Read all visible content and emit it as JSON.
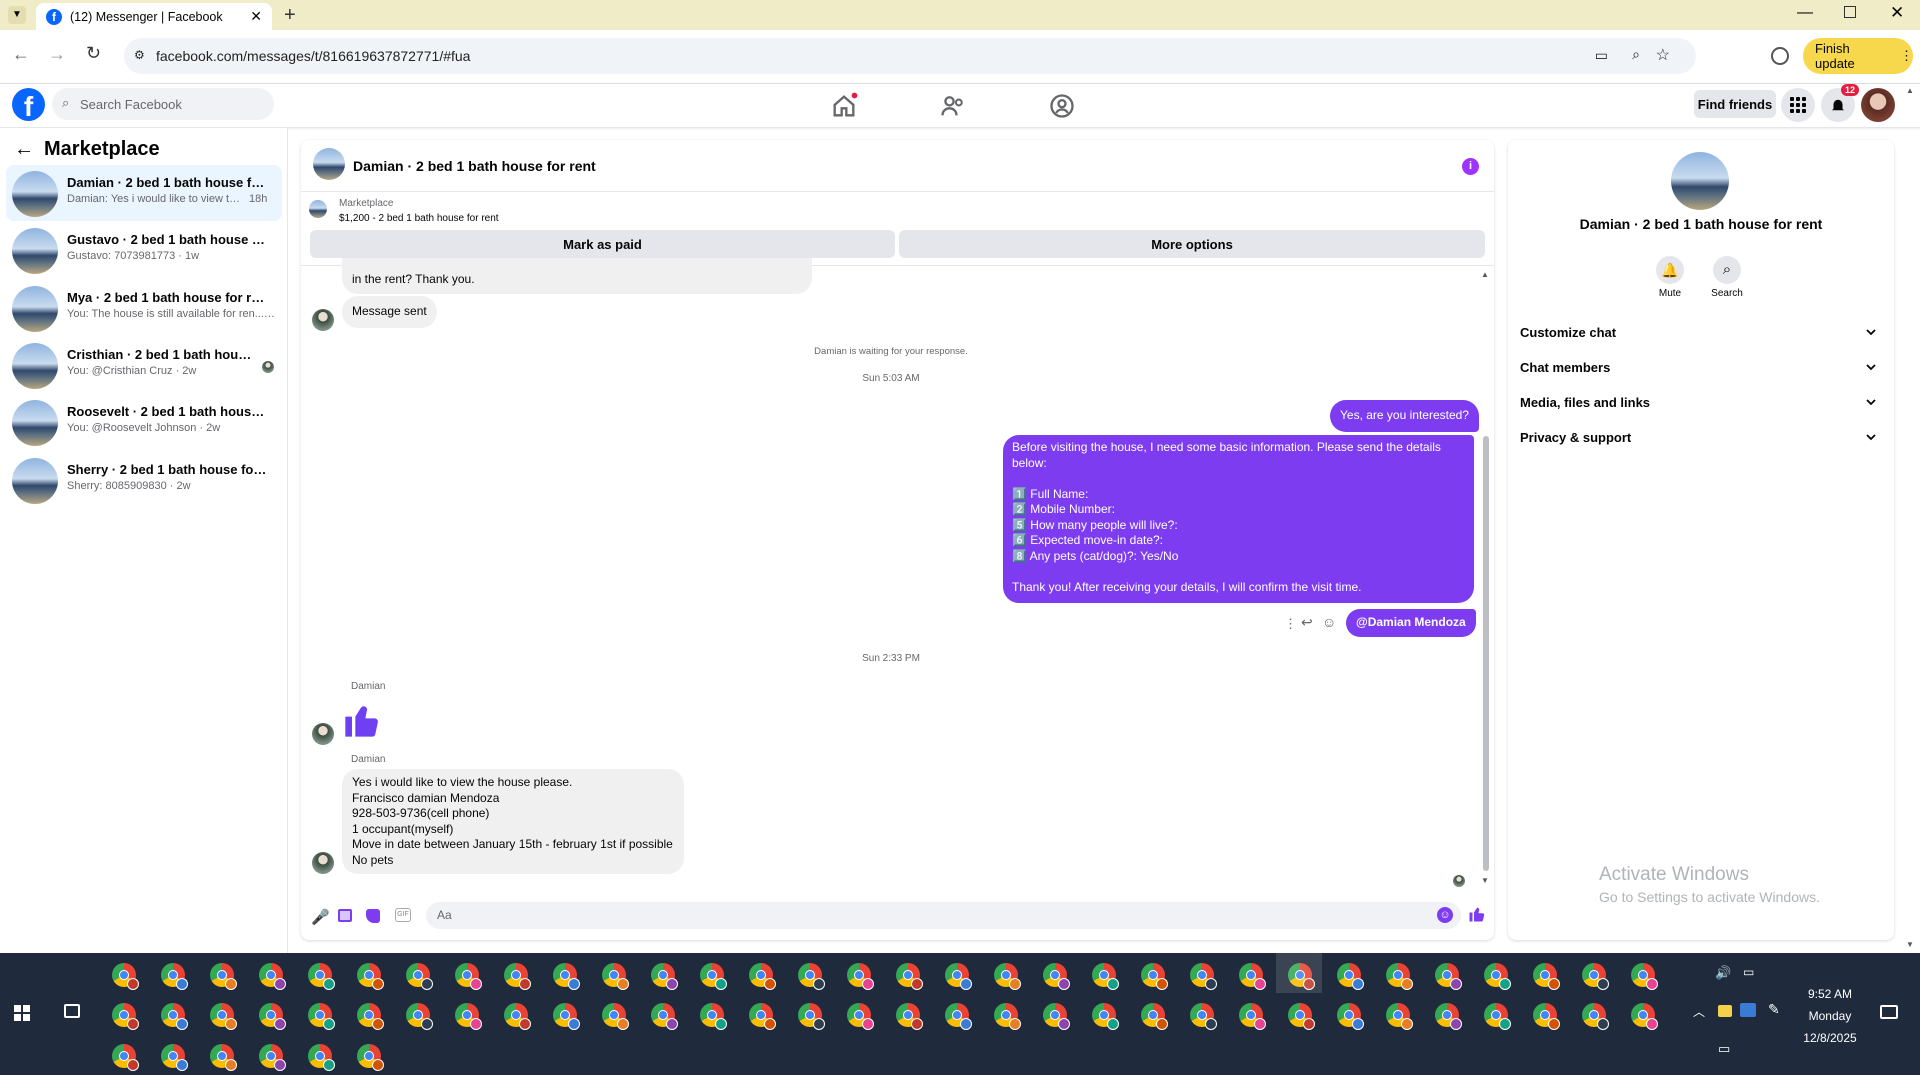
{
  "browser": {
    "tab_title": "(12) Messenger | Facebook",
    "url": "facebook.com/messages/t/816619637872771/#fua",
    "finish_update": "Finish update"
  },
  "fb_header": {
    "search_placeholder": "Search Facebook",
    "find_friends": "Find friends",
    "notification_count": "12"
  },
  "left_panel": {
    "title": "Marketplace",
    "conversations": [
      {
        "title": "Damian · 2 bed 1 bath house for re...",
        "snippet": "Damian: Yes i would like to view the ...",
        "time": "18h"
      },
      {
        "title": "Gustavo · 2 bed 1 bath house for r...",
        "snippet": "Gustavo: 7073981773 · 1w"
      },
      {
        "title": "Mya · 2 bed 1 bath house for rent",
        "snippet": "You: The house is still available for ren... · 2w"
      },
      {
        "title": "Cristhian · 2 bed 1 bath house fo...",
        "snippet": "You: @Cristhian Cruz · 2w"
      },
      {
        "title": "Roosevelt · 2 bed 1 bath house for ...",
        "snippet": "You: @Roosevelt Johnson · 2w"
      },
      {
        "title": "Sherry · 2 bed 1 bath house for rent",
        "snippet": "Sherry: 8085909830 · 2w"
      }
    ]
  },
  "chat": {
    "header_title": "Damian · 2 bed 1 bath house for rent",
    "listing_label": "Marketplace",
    "listing_price": "$1,200 - 2 bed 1 bath house for rent",
    "mark_paid": "Mark as paid",
    "more_options": "More options",
    "partial_bubble": "in the rent? Thank you.",
    "message_sent": "Message sent",
    "waiting": "Damian is waiting for your response.",
    "time1": "Sun 5:03 AM",
    "out1": "Yes, are you interested?",
    "out2_lines": [
      "Before visiting the house, I need some basic information. Please send the details",
      "below:",
      "",
      "1️⃣ Full Name:",
      "2️⃣ Mobile Number:",
      "5️⃣ How many people will live?:",
      "6️⃣ Expected move-in date?:",
      "8️⃣ Any pets (cat/dog)?: Yes/No",
      "",
      "Thank you! After receiving your details, I will confirm the visit time."
    ],
    "mention": "@Damian Mendoza",
    "time2": "Sun 2:33 PM",
    "sender1": "Damian",
    "sender2": "Damian",
    "in_lines": [
      "Yes i would like to view the house please.",
      "Francisco damian Mendoza",
      "928-503-9736(cell phone)",
      "1 occupant(myself)",
      "Move in date between January 15th - february 1st if possible",
      "No pets"
    ],
    "composer_placeholder": "Aa"
  },
  "right_panel": {
    "title": "Damian · 2 bed 1 bath house for rent",
    "mute": "Mute",
    "search": "Search",
    "items": [
      "Customize chat",
      "Chat members",
      "Media, files and links",
      "Privacy & support"
    ],
    "watermark_title": "Activate Windows",
    "watermark_sub": "Go to Settings to activate Windows."
  },
  "taskbar": {
    "time": "9:52 AM",
    "day": "Monday",
    "date": "12/8/2025"
  },
  "colors": {
    "accent": "#7d3cf0",
    "fb_blue": "#0866ff",
    "taskbar": "#1f2b3c"
  }
}
